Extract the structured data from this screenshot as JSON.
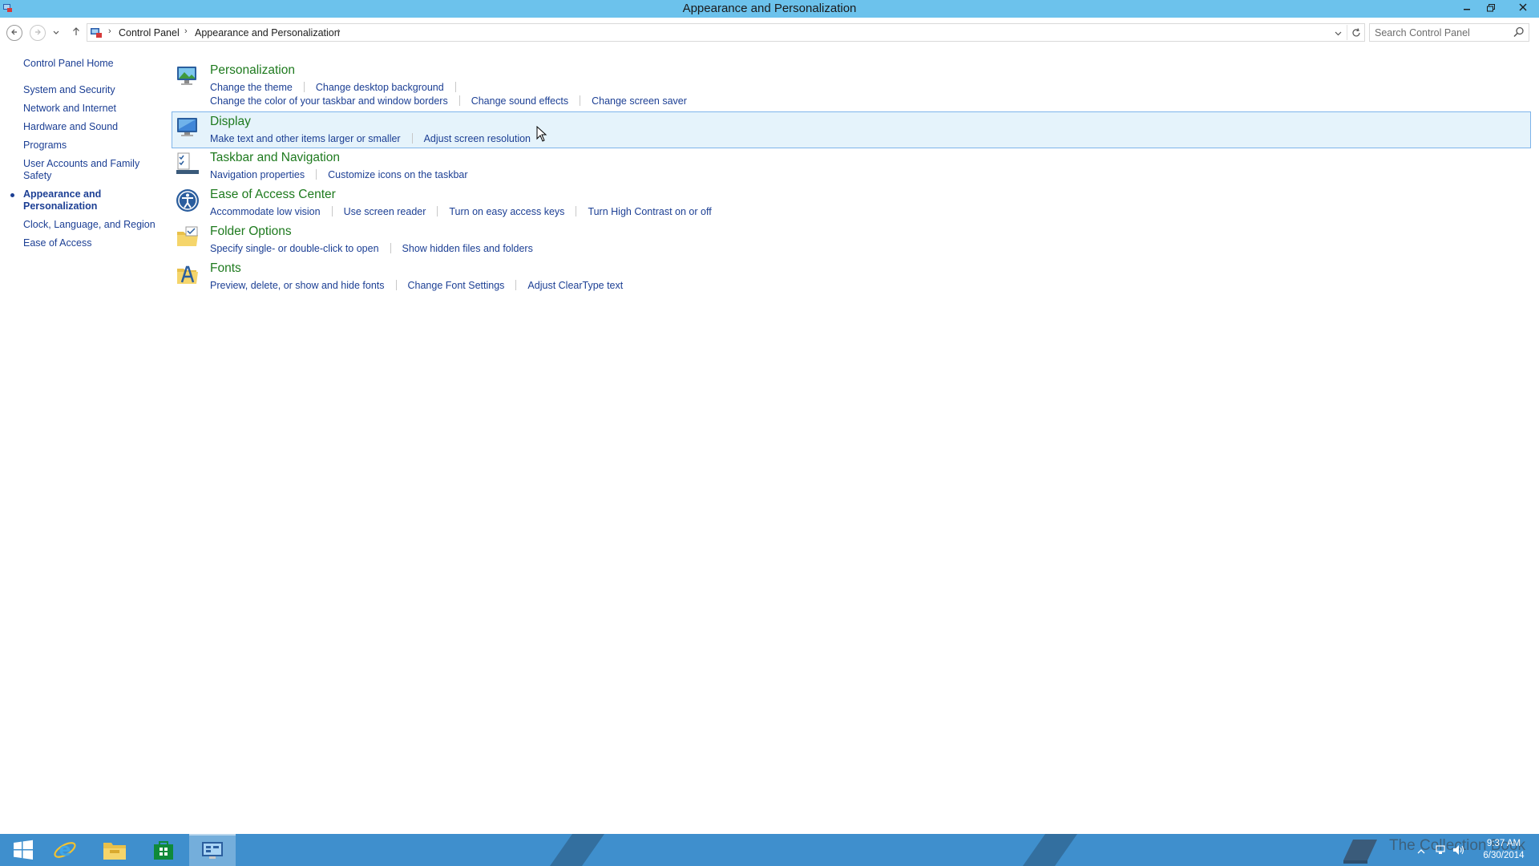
{
  "window": {
    "title": "Appearance and Personalization",
    "minimize_icon": "minimize-icon",
    "maximize_icon": "restore-icon",
    "close_icon": "close-icon"
  },
  "address": {
    "breadcrumbs": [
      "Control Panel",
      "Appearance and Personalization"
    ],
    "search_placeholder": "Search Control Panel"
  },
  "sidebar": {
    "home": "Control Panel Home",
    "items": [
      {
        "label": "System and Security",
        "current": false
      },
      {
        "label": "Network and Internet",
        "current": false
      },
      {
        "label": "Hardware and Sound",
        "current": false
      },
      {
        "label": "Programs",
        "current": false
      },
      {
        "label": "User Accounts and Family Safety",
        "current": false
      },
      {
        "label": "Appearance and Personalization",
        "current": true
      },
      {
        "label": "Clock, Language, and Region",
        "current": false
      },
      {
        "label": "Ease of Access",
        "current": false
      }
    ]
  },
  "main": {
    "tasks": [
      {
        "title": "Personalization",
        "icon": "personalization-icon",
        "links": [
          [
            "Change the theme",
            "Change desktop background"
          ],
          [
            "Change the color of your taskbar and window borders",
            "Change sound effects",
            "Change screen saver"
          ]
        ]
      },
      {
        "title": "Display",
        "icon": "display-icon",
        "links": [
          [
            "Make text and other items larger or smaller",
            "Adjust screen resolution"
          ]
        ]
      },
      {
        "title": "Taskbar and Navigation",
        "icon": "taskbar-icon",
        "links": [
          [
            "Navigation properties",
            "Customize icons on the taskbar"
          ]
        ]
      },
      {
        "title": "Ease of Access Center",
        "icon": "ease-of-access-icon",
        "links": [
          [
            "Accommodate low vision",
            "Use screen reader",
            "Turn on easy access keys",
            "Turn High Contrast on or off"
          ]
        ]
      },
      {
        "title": "Folder Options",
        "icon": "folder-options-icon",
        "links": [
          [
            "Specify single- or double-click to open",
            "Show hidden files and folders"
          ]
        ]
      },
      {
        "title": "Fonts",
        "icon": "fonts-icon",
        "links": [
          [
            "Preview, delete, or show and hide fonts",
            "Change Font Settings",
            "Adjust ClearType text"
          ]
        ]
      }
    ]
  },
  "taskbar": {
    "clock_time": "9:37 AM",
    "clock_date": "6/30/2014",
    "watermark": "The Collection Book"
  },
  "colors": {
    "titlebar": "#6cc2ec",
    "taskbar": "#3f8fcd",
    "link": "#1c3f94",
    "task_title": "#1e7a1e",
    "hover_bg": "#e5f3fb"
  }
}
